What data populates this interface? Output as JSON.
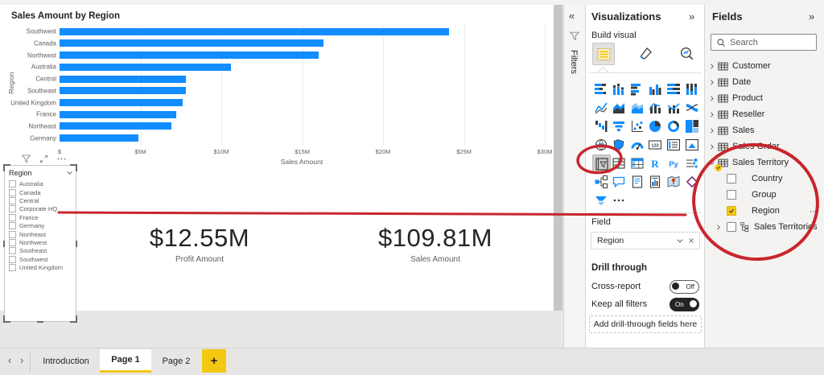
{
  "colors": {
    "accent_blue": "#118DFF",
    "brand_yellow": "#F2C811",
    "annotation_red": "#C8262C",
    "text_dark": "#252423",
    "text_gray": "#605E5C"
  },
  "chart": {
    "title": "Sales Amount by Region",
    "x_axis_label": "Sales Amount",
    "y_axis_label": "Region",
    "tick_labels": [
      "$",
      "$5M",
      "$10M",
      "$15M",
      "$20M",
      "$25M",
      "$30M"
    ]
  },
  "chart_data": {
    "type": "bar",
    "orientation": "horizontal",
    "title": "Sales Amount by Region",
    "categories": [
      "Southwest",
      "Canada",
      "Northwest",
      "Australia",
      "Central",
      "Southeast",
      "United Kingdom",
      "France",
      "Northeast",
      "Germany"
    ],
    "values": [
      24.1,
      16.3,
      16.0,
      10.6,
      7.8,
      7.8,
      7.6,
      7.2,
      6.9,
      4.9
    ],
    "unit": "$M",
    "xlabel": "Sales Amount",
    "ylabel": "Region",
    "xlim": [
      0,
      30
    ],
    "x_ticks": [
      "$",
      "$5M",
      "$10M",
      "$15M",
      "$20M",
      "$25M",
      "$30M"
    ],
    "grid": true,
    "legend": false
  },
  "slicer_toolbar": {
    "icons": [
      "filter-funnel",
      "focus-mode",
      "more-dots"
    ]
  },
  "slicer": {
    "header": "Region",
    "items": [
      "Australia",
      "Canada",
      "Central",
      "Corporate HQ",
      "France",
      "Germany",
      "Northeast",
      "Northwest",
      "Southeast",
      "Southwest",
      "United Kingdom"
    ]
  },
  "cards": [
    {
      "value": "$12.55M",
      "label": "Profit Amount"
    },
    {
      "value": "$109.81M",
      "label": "Sales Amount"
    }
  ],
  "filters_pane": {
    "collapse_glyph": "«",
    "label": "Filters"
  },
  "viz_pane": {
    "title": "Visualizations",
    "expand_glyph": "»",
    "build_label": "Build visual",
    "mode_icons": [
      "slicer-build",
      "format-icon",
      "analytics-icon"
    ],
    "grid_icons": [
      {
        "name": "stacked-bar-chart"
      },
      {
        "name": "stacked-column-chart"
      },
      {
        "name": "clustered-bar-chart"
      },
      {
        "name": "clustered-column-chart"
      },
      {
        "name": "hundred-stacked-bar-chart"
      },
      {
        "name": "hundred-stacked-column-chart"
      },
      {
        "name": "line-chart"
      },
      {
        "name": "area-chart"
      },
      {
        "name": "stacked-area-chart"
      },
      {
        "name": "line-stacked-column-chart"
      },
      {
        "name": "line-clustered-column-chart"
      },
      {
        "name": "ribbon-chart"
      },
      {
        "name": "waterfall-chart"
      },
      {
        "name": "funnel-chart"
      },
      {
        "name": "scatter-chart"
      },
      {
        "name": "pie-chart"
      },
      {
        "name": "donut-chart"
      },
      {
        "name": "treemap"
      },
      {
        "name": "map"
      },
      {
        "name": "filled-map"
      },
      {
        "name": "gauge"
      },
      {
        "name": "card"
      },
      {
        "name": "multi-row-card"
      },
      {
        "name": "kpi"
      },
      {
        "name": "slicer",
        "selected": true
      },
      {
        "name": "table"
      },
      {
        "name": "matrix"
      },
      {
        "name": "r-script"
      },
      {
        "name": "python-visual"
      },
      {
        "name": "key-influencers"
      },
      {
        "name": "decomposition-tree"
      },
      {
        "name": "qa"
      },
      {
        "name": "smart-narrative"
      },
      {
        "name": "paginated-report"
      },
      {
        "name": "arcgis-map"
      },
      {
        "name": "power-apps"
      },
      {
        "name": "power-automate"
      },
      {
        "name": "more-options"
      }
    ],
    "field_section": {
      "label": "Field",
      "well_value": "Region"
    },
    "drill": {
      "header": "Drill through",
      "cross_report_label": "Cross-report",
      "cross_report_state": "Off",
      "keep_filters_label": "Keep all filters",
      "keep_filters_state": "On",
      "drop_hint": "Add drill-through fields here"
    }
  },
  "fields_pane": {
    "title": "Fields",
    "expand_glyph": "»",
    "search_placeholder": "Search",
    "tables": [
      "Customer",
      "Date",
      "Product",
      "Reseller",
      "Sales",
      "Sales Order"
    ],
    "expanded_table": {
      "name": "Sales Territory",
      "children": [
        {
          "name": "Country",
          "checked": false
        },
        {
          "name": "Group",
          "checked": false
        },
        {
          "name": "Region",
          "checked": true,
          "more_glyph": "⋯"
        },
        {
          "name": "Sales Territories",
          "checked": false,
          "hierarchy": true,
          "expandable": true
        }
      ]
    }
  },
  "page_tabs": {
    "prev_glyph": "‹",
    "next_glyph": "›",
    "tabs": [
      {
        "label": "Introduction",
        "active": false
      },
      {
        "label": "Page 1",
        "active": true
      },
      {
        "label": "Page 2",
        "active": false
      }
    ],
    "add_label": "+"
  }
}
